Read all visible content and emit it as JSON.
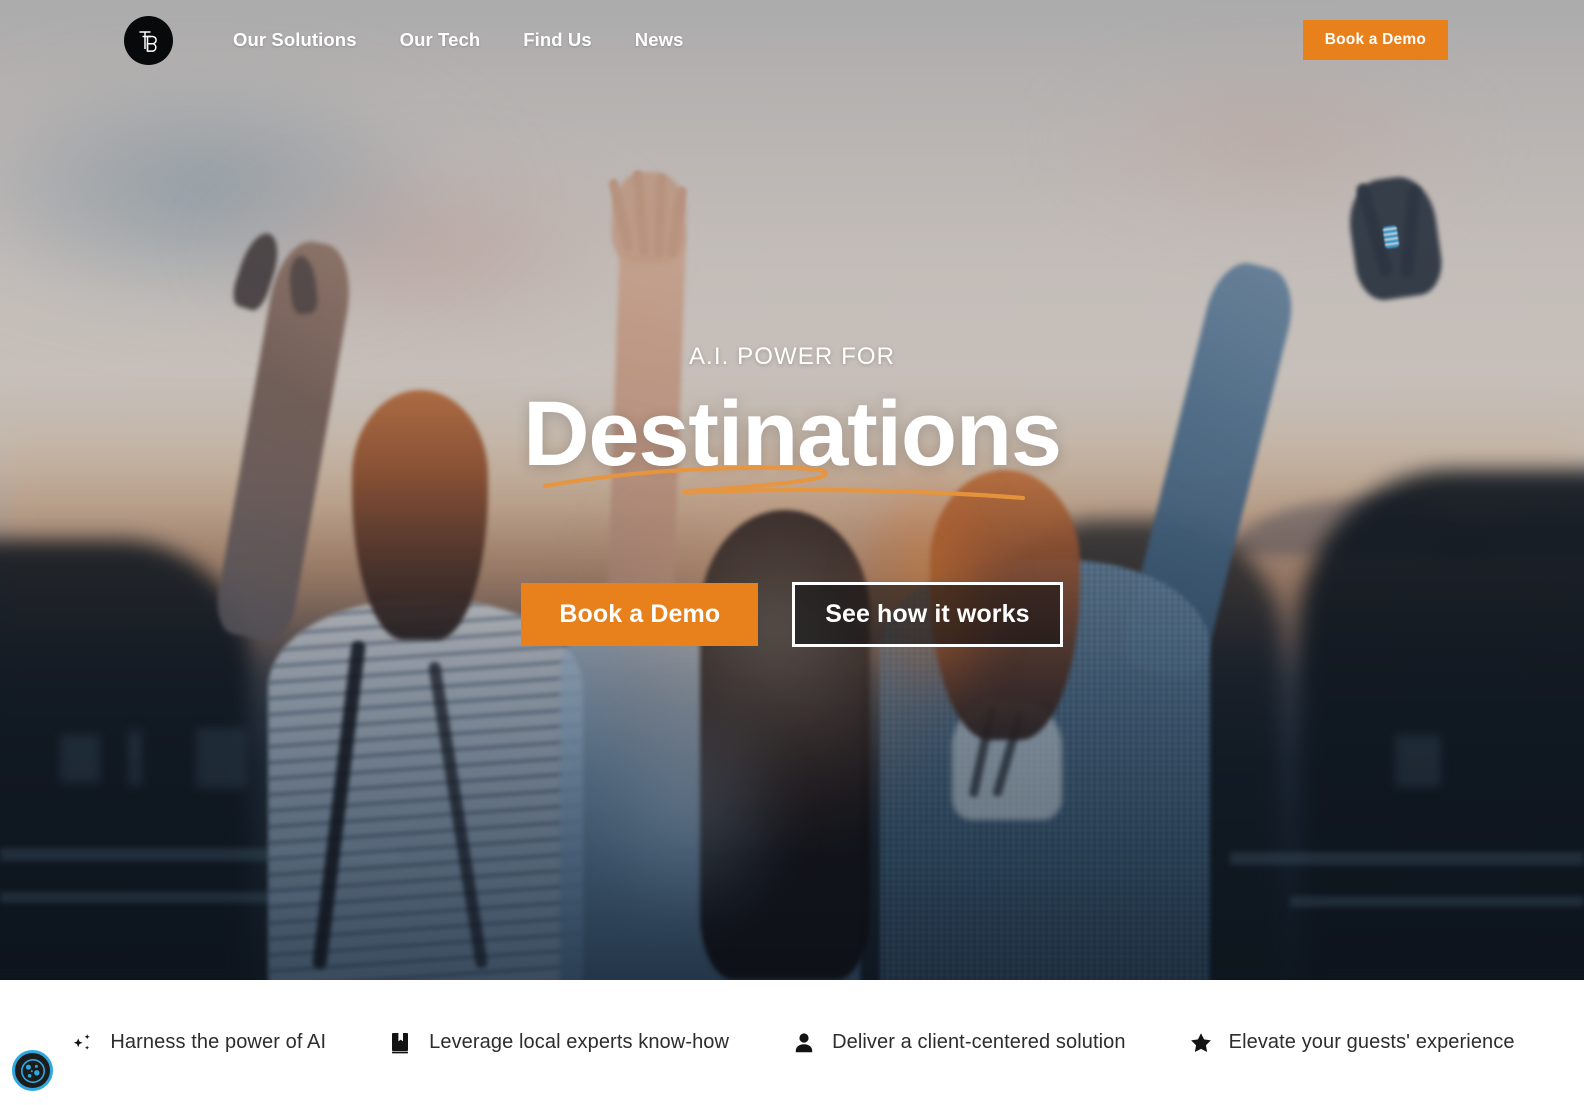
{
  "brand": {
    "logo_icon": "tb-monogram-logo",
    "logo_text": "TB"
  },
  "header": {
    "nav": [
      {
        "label": "Our Solutions"
      },
      {
        "label": "Our Tech"
      },
      {
        "label": "Find Us"
      },
      {
        "label": "News"
      }
    ],
    "cta_label": "Book a Demo"
  },
  "hero": {
    "eyebrow": "A.I. POWER FOR",
    "headline": "Destinations",
    "primary_cta": "Book a Demo",
    "secondary_cta": "See how it works",
    "underline_icon": "orange-swoosh-underline"
  },
  "features": [
    {
      "icon": "sparkle-icon",
      "label": "Harness the power of AI"
    },
    {
      "icon": "book-icon",
      "label": "Leverage local experts know-how"
    },
    {
      "icon": "person-icon",
      "label": "Deliver a client-centered solution"
    },
    {
      "icon": "star-icon",
      "label": "Elevate your guests' experience"
    }
  ],
  "cookie": {
    "icon": "cookie-consent-icon"
  },
  "colors": {
    "accent_orange": "#e8801c",
    "swoosh_orange": "#e8953c",
    "cookie_cyan": "#2fa8e0",
    "text_dark": "#2d2d2d",
    "white": "#ffffff"
  }
}
